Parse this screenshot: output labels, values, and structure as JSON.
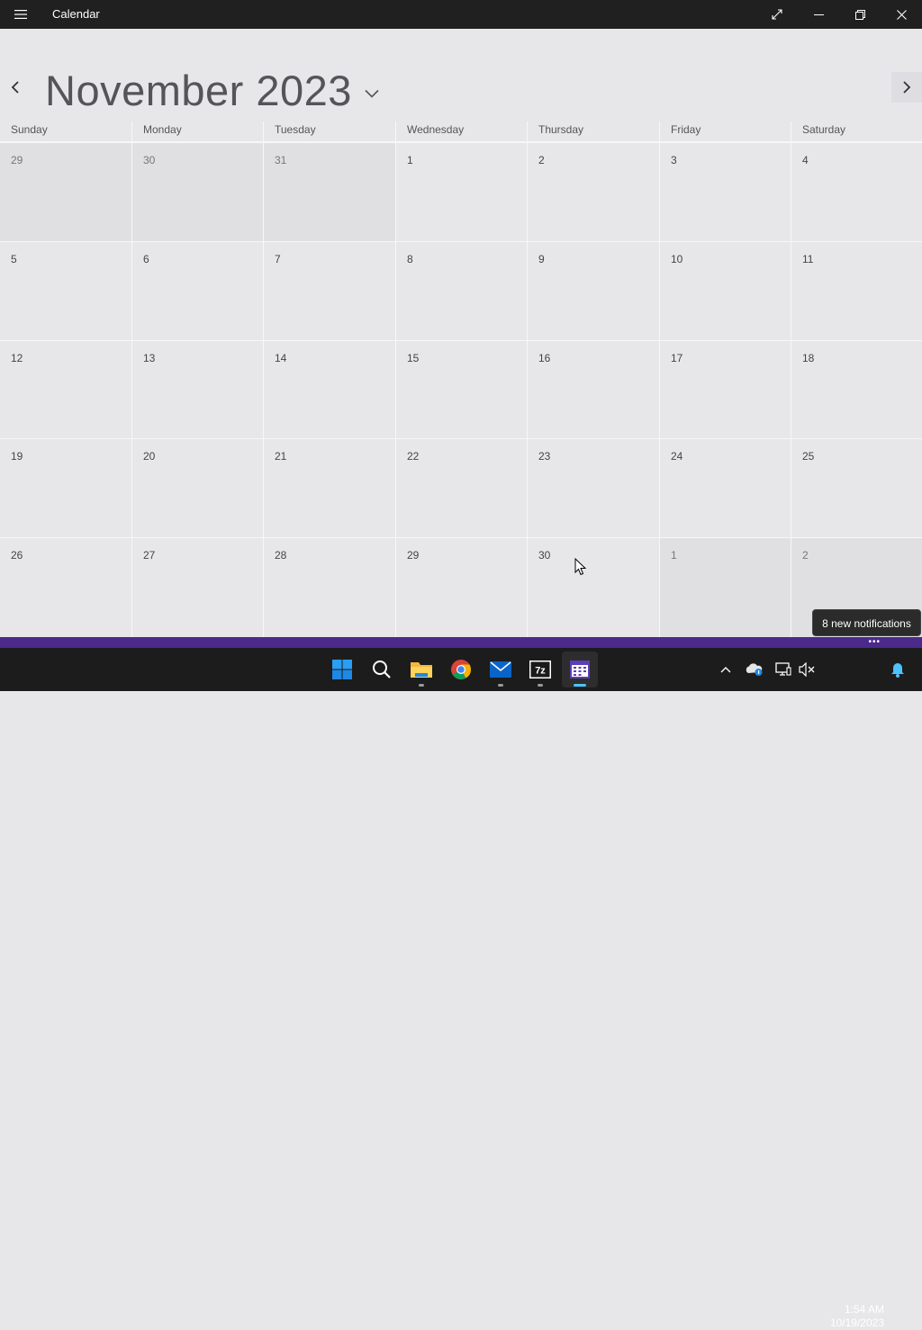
{
  "window": {
    "title": "Calendar",
    "accent_color": "#4b2a8c"
  },
  "calendar": {
    "month_title": "November 2023",
    "day_headers": [
      "Sunday",
      "Monday",
      "Tuesday",
      "Wednesday",
      "Thursday",
      "Friday",
      "Saturday"
    ],
    "weeks": [
      [
        {
          "day": "29",
          "other": true
        },
        {
          "day": "30",
          "other": true
        },
        {
          "day": "31",
          "other": true
        },
        {
          "day": "1"
        },
        {
          "day": "2"
        },
        {
          "day": "3"
        },
        {
          "day": "4"
        }
      ],
      [
        {
          "day": "5"
        },
        {
          "day": "6"
        },
        {
          "day": "7"
        },
        {
          "day": "8"
        },
        {
          "day": "9"
        },
        {
          "day": "10"
        },
        {
          "day": "11"
        }
      ],
      [
        {
          "day": "12"
        },
        {
          "day": "13"
        },
        {
          "day": "14"
        },
        {
          "day": "15"
        },
        {
          "day": "16"
        },
        {
          "day": "17"
        },
        {
          "day": "18"
        }
      ],
      [
        {
          "day": "19"
        },
        {
          "day": "20"
        },
        {
          "day": "21"
        },
        {
          "day": "22"
        },
        {
          "day": "23"
        },
        {
          "day": "24"
        },
        {
          "day": "25"
        }
      ],
      [
        {
          "day": "26"
        },
        {
          "day": "27"
        },
        {
          "day": "28"
        },
        {
          "day": "29"
        },
        {
          "day": "30"
        },
        {
          "day": "1",
          "other": true
        },
        {
          "day": "2",
          "other": true
        }
      ]
    ]
  },
  "notifications": {
    "tooltip": "8 new notifications",
    "more_label": "•••"
  },
  "taskbar": {
    "apps": [
      "start-icon",
      "search-icon",
      "file-explorer-icon",
      "chrome-icon",
      "mail-icon",
      "7zip-icon",
      "calendar-app-icon"
    ],
    "time": "1:54 AM",
    "date": "10/19/2023"
  }
}
